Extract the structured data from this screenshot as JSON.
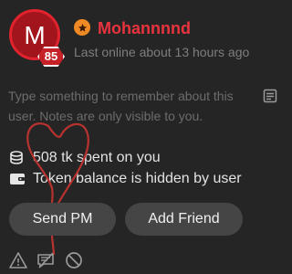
{
  "profile": {
    "avatar_letter": "M",
    "level": "85",
    "username": "Mohannnnd",
    "last_online": "Last online about 13 hours ago"
  },
  "notes": {
    "placeholder": "Type something to remember about this user. Notes are only visible to you.",
    "icon": "notes-icon"
  },
  "stats": {
    "spent": "508 tk spent on you",
    "token_balance": "Token balance is hidden by user"
  },
  "actions": {
    "send_pm": "Send PM",
    "add_friend": "Add Friend"
  },
  "footer_icons": [
    "warning-icon",
    "flag-icon",
    "block-icon"
  ],
  "colors": {
    "accent": "#e9343e",
    "avatar_bg": "#a3151c",
    "rank_badge": "#f08a24",
    "button_bg": "#454545",
    "background": "#252525"
  }
}
